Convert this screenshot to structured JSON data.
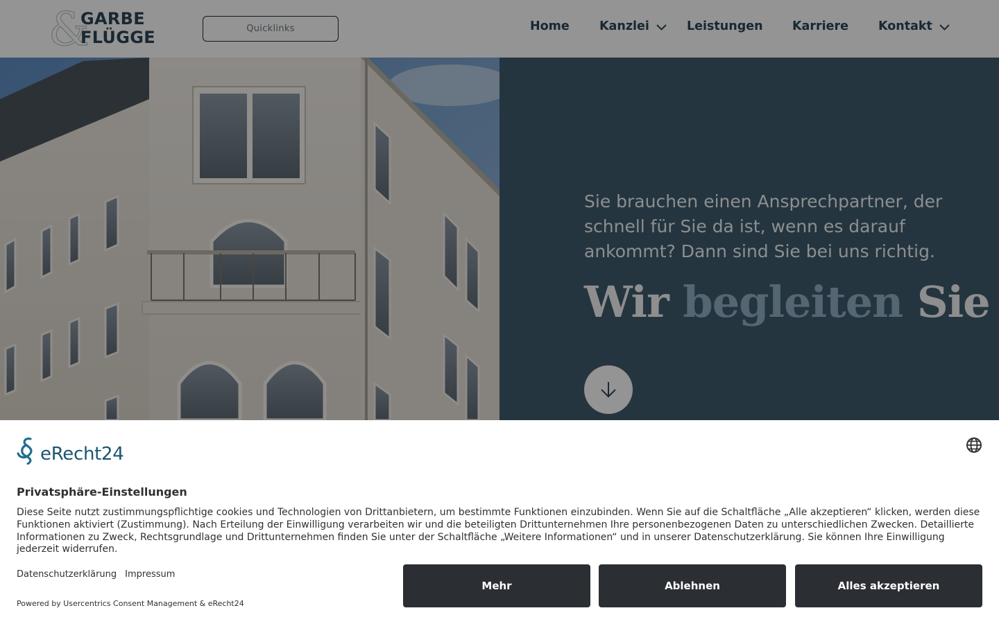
{
  "header": {
    "logo_line1": "GARBE",
    "logo_line2": "FLÜGGE",
    "logo_amp": "&",
    "quicklinks": "Quicklinks",
    "nav": [
      {
        "label": "Home"
      },
      {
        "label": "Kanzlei",
        "dropdown": true
      },
      {
        "label": "Leistungen"
      },
      {
        "label": "Karriere"
      },
      {
        "label": "Kontakt",
        "dropdown": true
      }
    ]
  },
  "hero": {
    "intro": "Sie brauchen einen Ansprechpartner, der schnell für Sie da ist, wenn es darauf ankommt? Dann sind Sie bei uns richtig.",
    "title_part1": "Wir",
    "title_accent": "begleiten",
    "title_part2": "Sie",
    "scroll_icon": "arrow-down-icon"
  },
  "consent": {
    "logo_text": "eRecht24",
    "language_icon": "globe-icon",
    "title": "Privatsphäre-Einstellungen",
    "text": "Diese Seite nutzt zustimmungspflichtige cookies und Technologien von Drittanbietern, um bestimmte Funktionen einzubinden. Wenn Sie auf die Schaltfläche „Alle akzeptieren“ klicken, werden diese Funktionen aktiviert (Zustimmung). Nach Erteilung der Einwilligung verarbeiten wir und die beteiligten Drittunternehmen Ihre personenbezogenen Daten zu unterschiedlichen Zwecken. Detaillierte Informationen zu Zweck, Rechtsgrundlage und Drittunternehmen finden Sie unter der Schaltfläche „Weitere Informationen“ und in unserer Datenschutzerklärung. Sie können Ihre Einwilligung jederzeit widerrufen.",
    "link_privacy": "Datenschutzerklärung",
    "link_imprint": "Impressum",
    "powered_by": "Powered by Usercentrics Consent Management & eRecht24",
    "btn_more": "Mehr",
    "btn_deny": "Ablehnen",
    "btn_accept": "Alles akzeptieren"
  },
  "colors": {
    "brand_dark": "#2b4657",
    "hero_panel": "#3f5c6e",
    "hero_accent": "#8fb0c3",
    "button_dark": "#2b2e32"
  }
}
